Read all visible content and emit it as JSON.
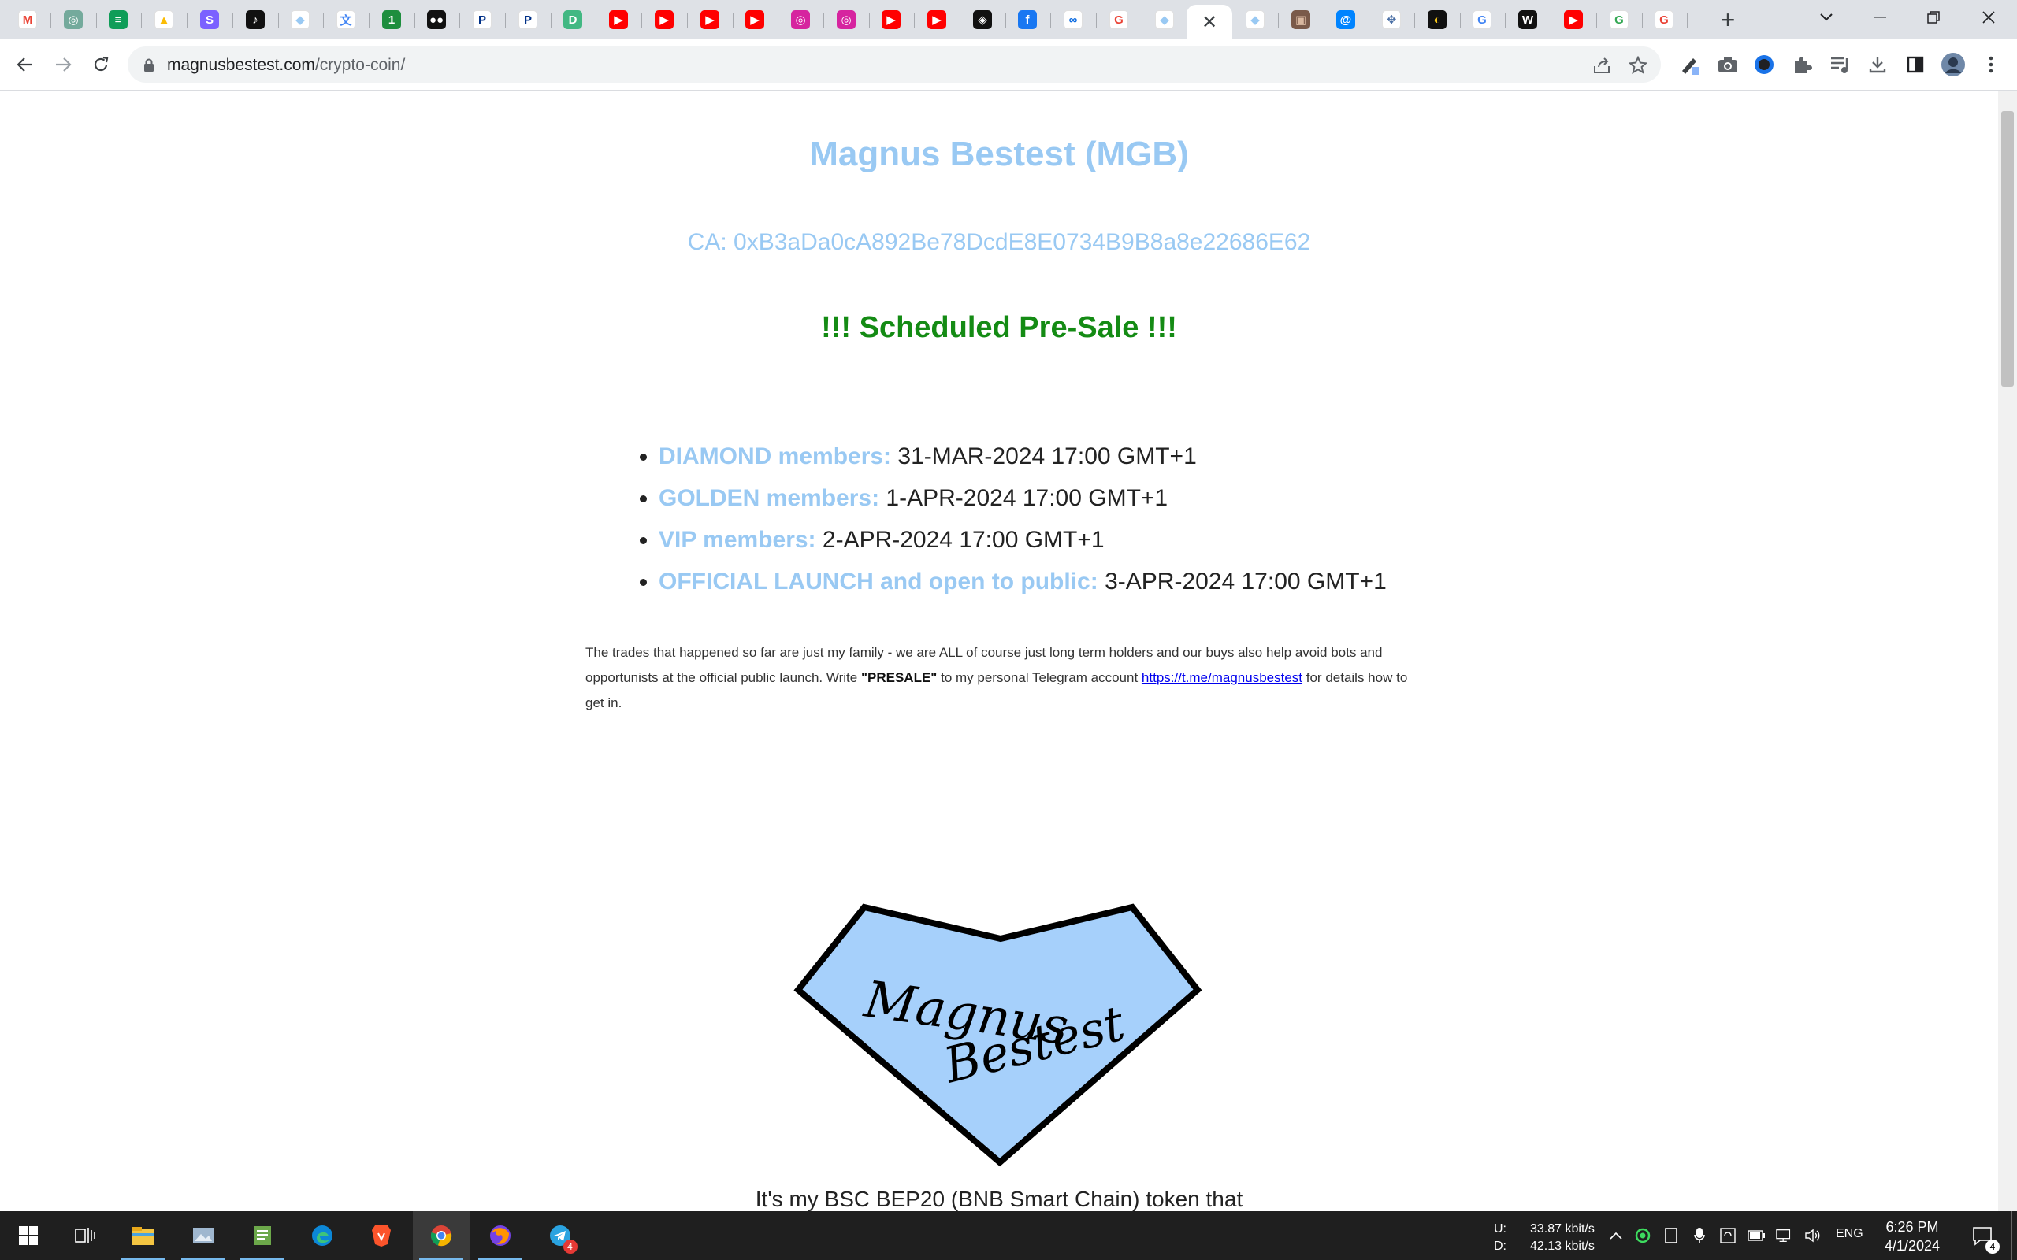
{
  "browser": {
    "tabs": [
      {
        "icon": "gmail-icon",
        "glyph": "M",
        "bg": "#ffffff",
        "fg": "#ea4335"
      },
      {
        "icon": "chatgpt-icon",
        "glyph": "◎",
        "bg": "#74aa9c",
        "fg": "#ffffff"
      },
      {
        "icon": "google-forms-icon",
        "glyph": "≡",
        "bg": "#0f9d58",
        "fg": "#ffffff"
      },
      {
        "icon": "google-ads-icon",
        "glyph": "▲",
        "bg": "#ffffff",
        "fg": "#fbbc04"
      },
      {
        "icon": "s-app-icon",
        "glyph": "S",
        "bg": "#7b61ff",
        "fg": "#ffffff"
      },
      {
        "icon": "tiktok-icon",
        "glyph": "♪",
        "bg": "#111111",
        "fg": "#ffffff"
      },
      {
        "icon": "diamond-icon",
        "glyph": "◆",
        "bg": "#ffffff",
        "fg": "#99c9f3"
      },
      {
        "icon": "translate-icon",
        "glyph": "文",
        "bg": "#ffffff",
        "fg": "#4285f4"
      },
      {
        "icon": "notification-badge-icon",
        "glyph": "1",
        "bg": "#1e8e3e",
        "fg": "#ffffff"
      },
      {
        "icon": "medium-icon",
        "glyph": "●●",
        "bg": "#111111",
        "fg": "#ffffff"
      },
      {
        "icon": "paypal-icon",
        "glyph": "P",
        "bg": "#ffffff",
        "fg": "#003087"
      },
      {
        "icon": "paypal-icon",
        "glyph": "P",
        "bg": "#ffffff",
        "fg": "#003087"
      },
      {
        "icon": "bookmark-app-icon",
        "glyph": "D",
        "bg": "#42b883",
        "fg": "#ffffff"
      },
      {
        "icon": "youtube-icon",
        "glyph": "▶",
        "bg": "#ff0000",
        "fg": "#ffffff"
      },
      {
        "icon": "youtube-icon",
        "glyph": "▶",
        "bg": "#ff0000",
        "fg": "#ffffff"
      },
      {
        "icon": "youtube-icon",
        "glyph": "▶",
        "bg": "#ff0000",
        "fg": "#ffffff"
      },
      {
        "icon": "youtube-icon",
        "glyph": "▶",
        "bg": "#ff0000",
        "fg": "#ffffff"
      },
      {
        "icon": "instagram-icon",
        "glyph": "◎",
        "bg": "#d6249f",
        "fg": "#ffffff"
      },
      {
        "icon": "instagram-icon",
        "glyph": "◎",
        "bg": "#d6249f",
        "fg": "#ffffff"
      },
      {
        "icon": "youtube-icon",
        "glyph": "▶",
        "bg": "#ff0000",
        "fg": "#ffffff"
      },
      {
        "icon": "youtube-icon",
        "glyph": "▶",
        "bg": "#ff0000",
        "fg": "#ffffff"
      },
      {
        "icon": "app-circle-icon",
        "glyph": "◈",
        "bg": "#111111",
        "fg": "#ffffff"
      },
      {
        "icon": "facebook-icon",
        "glyph": "f",
        "bg": "#1877f2",
        "fg": "#ffffff"
      },
      {
        "icon": "meta-icon",
        "glyph": "∞",
        "bg": "#ffffff",
        "fg": "#0668e1"
      },
      {
        "icon": "google-icon",
        "glyph": "G",
        "bg": "#ffffff",
        "fg": "#ea4335"
      },
      {
        "icon": "diamond-icon",
        "glyph": "◆",
        "bg": "#ffffff",
        "fg": "#99c9f3"
      },
      {
        "icon": "close-icon",
        "glyph": "✕",
        "bg": "transparent",
        "fg": "#3c4043",
        "active": true
      },
      {
        "icon": "diamond-icon",
        "glyph": "◆",
        "bg": "#ffffff",
        "fg": "#99c9f3"
      },
      {
        "icon": "photo-thumbnail-icon",
        "glyph": "▣",
        "bg": "#7a5a4a",
        "fg": "#d9b8a0"
      },
      {
        "icon": "messenger-icon",
        "glyph": "@",
        "bg": "#0084ff",
        "fg": "#ffffff"
      },
      {
        "icon": "move-icon",
        "glyph": "✥",
        "bg": "#ffffff",
        "fg": "#4a6fa5"
      },
      {
        "icon": "chart-app-icon",
        "glyph": "◐",
        "bg": "#111111",
        "fg": "#f5c518"
      },
      {
        "icon": "google-icon",
        "glyph": "G",
        "bg": "#ffffff",
        "fg": "#4285f4"
      },
      {
        "icon": "wikipedia-icon",
        "glyph": "W",
        "bg": "#111111",
        "fg": "#ffffff"
      },
      {
        "icon": "youtube-icon",
        "glyph": "▶",
        "bg": "#ff0000",
        "fg": "#ffffff"
      },
      {
        "icon": "google-icon",
        "glyph": "G",
        "bg": "#ffffff",
        "fg": "#34a853"
      },
      {
        "icon": "google-icon",
        "glyph": "G",
        "bg": "#ffffff",
        "fg": "#ea4335"
      }
    ],
    "url_host": "magnusbestest.com",
    "url_path": "/crypto-coin/"
  },
  "page": {
    "title": "Magnus Bestest (MGB)",
    "contract": "CA: 0xB3aDa0cA892Be78DcdE8E0734B9B8a8e22686E62",
    "presale_heading": "!!! Scheduled Pre-Sale !!!",
    "schedule": [
      {
        "label": "DIAMOND members:",
        "date": "31-MAR-2024 17:00 GMT+1"
      },
      {
        "label": "GOLDEN members:",
        "date": "1-APR-2024 17:00 GMT+1"
      },
      {
        "label": "VIP members:",
        "date": "2-APR-2024 17:00 GMT+1"
      },
      {
        "label": "OFFICIAL LAUNCH and open to public:",
        "date": "3-APR-2024 17:00 GMT+1"
      }
    ],
    "note_part1": "The trades that happened so far are just my family - we are ALL of course just long term holders and our buys also help avoid bots and opportunists at the official public launch. Write ",
    "note_bold": "\"PRESALE\"",
    "note_part2": " to my personal Telegram account ",
    "note_link": "https://t.me/magnusbestest",
    "note_part3": " for details how to get in.",
    "logo_text_line1": "Magnus",
    "logo_text_line2": "Bestest",
    "bottom_text": "It's my BSC BEP20 (BNB Smart Chain) token that"
  },
  "colors": {
    "accent": "#99c9f3",
    "presale": "#148b14",
    "logo_fill": "#a6d0fb"
  },
  "taskbar": {
    "apps": [
      {
        "icon": "file-explorer-icon",
        "running": true
      },
      {
        "icon": "image-viewer-icon",
        "running": true
      },
      {
        "icon": "notepad-icon",
        "running": true
      },
      {
        "icon": "edge-icon",
        "running": false
      },
      {
        "icon": "brave-icon",
        "running": false
      },
      {
        "icon": "chrome-icon",
        "running": true,
        "active": true
      },
      {
        "icon": "firefox-icon",
        "running": true
      },
      {
        "icon": "telegram-icon",
        "running": false,
        "badge": "4"
      }
    ],
    "net_up_label": "U:",
    "net_up": "33.87 kbit/s",
    "net_down_label": "D:",
    "net_down": "42.13 kbit/s",
    "lang": "ENG",
    "time": "6:26 PM",
    "date": "4/1/2024",
    "notification_count": "4"
  }
}
